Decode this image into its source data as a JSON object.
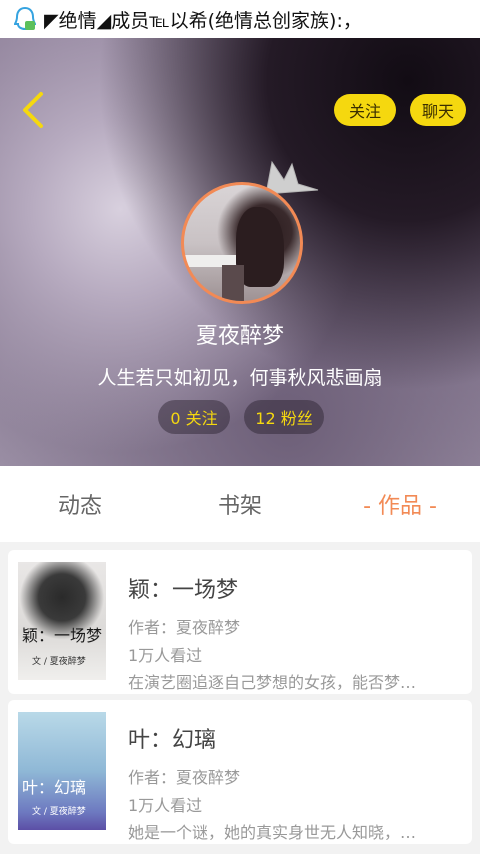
{
  "statusbar": {
    "text": "◤绝情◢成员℡以希(绝情总创家族):，"
  },
  "header": {
    "follow_label": "关注",
    "chat_label": "聊天"
  },
  "profile": {
    "username": "夏夜醉梦",
    "bio": "人生若只如初见，何事秋风悲画扇",
    "following": "0 关注",
    "fans": "12 粉丝"
  },
  "tabs": [
    {
      "label": "动态"
    },
    {
      "label": "书架"
    },
    {
      "label": "- 作品 -"
    }
  ],
  "works": [
    {
      "title": "颖：一场梦",
      "cover_title": "颖：一场梦",
      "cover_sub": "文 / 夏夜醉梦",
      "author": "作者：夏夜醉梦",
      "views": "1万人看过",
      "desc": "在演艺圈追逐自己梦想的女孩，能否梦…"
    },
    {
      "title": "叶：幻璃",
      "cover_title": "叶：幻璃",
      "cover_sub": "文 / 夏夜醉梦",
      "author": "作者：夏夜醉梦",
      "views": "1万人看过",
      "desc": "她是一个谜，她的真实身世无人知晓，…"
    }
  ],
  "colors": {
    "accent": "#f28a55",
    "button_yellow": "#f5d80f"
  }
}
